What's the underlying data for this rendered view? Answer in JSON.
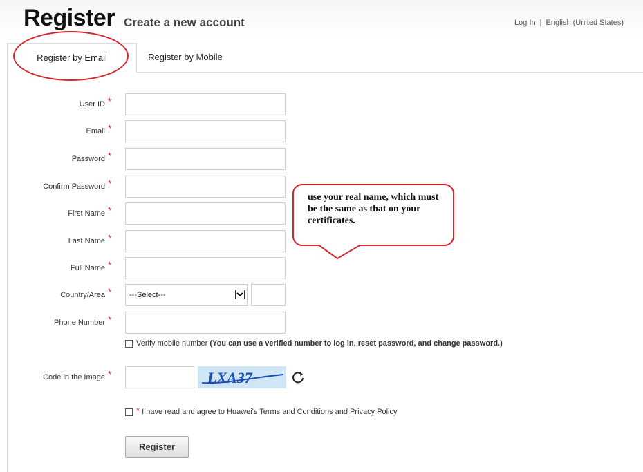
{
  "header": {
    "title": "Register",
    "subtitle": "Create a new account",
    "login_link": "Log In",
    "separator": "|",
    "language": "English (United States)"
  },
  "tabs": [
    {
      "label": "Register by Email",
      "active": true
    },
    {
      "label": "Register by Mobile",
      "active": false
    }
  ],
  "form": {
    "required_mark": "*",
    "fields": {
      "user_id": {
        "label": "User ID",
        "value": ""
      },
      "email": {
        "label": "Email",
        "value": ""
      },
      "password": {
        "label": "Password",
        "value": ""
      },
      "confirm_password": {
        "label": "Confirm Password",
        "value": ""
      },
      "first_name": {
        "label": "First Name",
        "value": ""
      },
      "last_name": {
        "label": "Last Name",
        "value": ""
      },
      "full_name": {
        "label": "Full Name",
        "value": ""
      },
      "country": {
        "label": "Country/Area",
        "selected": "---Select---",
        "code": ""
      },
      "phone": {
        "label": "Phone Number",
        "value": ""
      },
      "captcha": {
        "label": "Code in the Image",
        "value": "",
        "image_text": "LXA37"
      }
    },
    "verify_mobile": {
      "label": "Verify mobile number",
      "note": "(You can use a verified number to log in, reset password, and change password.)",
      "checked": false
    },
    "agreement": {
      "prefix": "I have read and agree to",
      "terms_link": "Huawei's Terms and Conditions",
      "and": "and",
      "privacy_link": "Privacy Policy",
      "checked": false
    },
    "submit_label": "Register"
  },
  "annotation": {
    "text": "use your real name, which must be the same as that on your certificates."
  },
  "colors": {
    "annotation_red": "#d6252c",
    "captcha_bg": "#cfe6f7",
    "captcha_ink": "#1b4fb5"
  }
}
